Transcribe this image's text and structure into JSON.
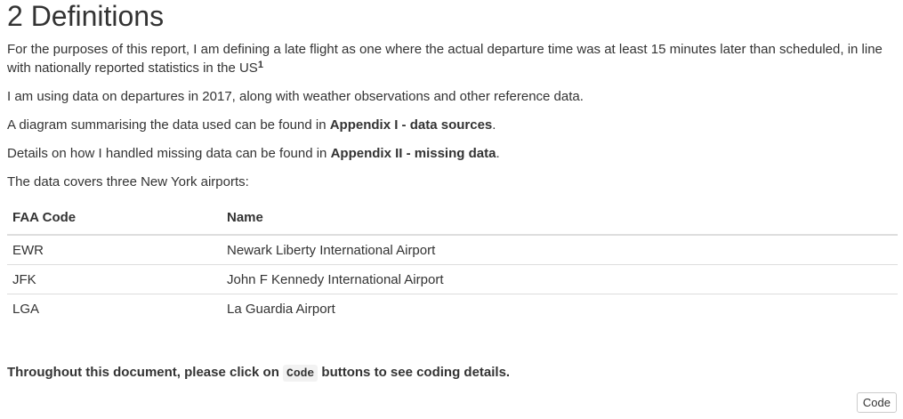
{
  "section": {
    "title": "2 Definitions"
  },
  "paragraphs": {
    "p1_text": "For the purposes of this report, I am defining a late flight as one where the actual departure time was at least 15 minutes later than scheduled, in line with nationally reported statistics in the US",
    "p1_footnote": "1",
    "p2_text": "I am using data on departures in 2017, along with weather observations and other reference data.",
    "p3_prefix": "A diagram summarising the data used can be found in ",
    "p3_link": "Appendix I - data sources",
    "p3_suffix": ".",
    "p4_prefix": "Details on how I handled missing data can be found in ",
    "p4_link": "Appendix II - missing data",
    "p4_suffix": ".",
    "p5_text": "The data covers three New York airports:"
  },
  "airports_table": {
    "headers": [
      "FAA Code",
      "Name"
    ],
    "rows": [
      [
        "EWR",
        "Newark Liberty International Airport"
      ],
      [
        "JFK",
        "John F Kennedy International Airport"
      ],
      [
        "LGA",
        "La Guardia Airport"
      ]
    ]
  },
  "note": {
    "prefix": "Throughout this document, please click on ",
    "code": "Code",
    "suffix": " buttons to see coding details."
  },
  "code_button": {
    "label": "Code"
  }
}
